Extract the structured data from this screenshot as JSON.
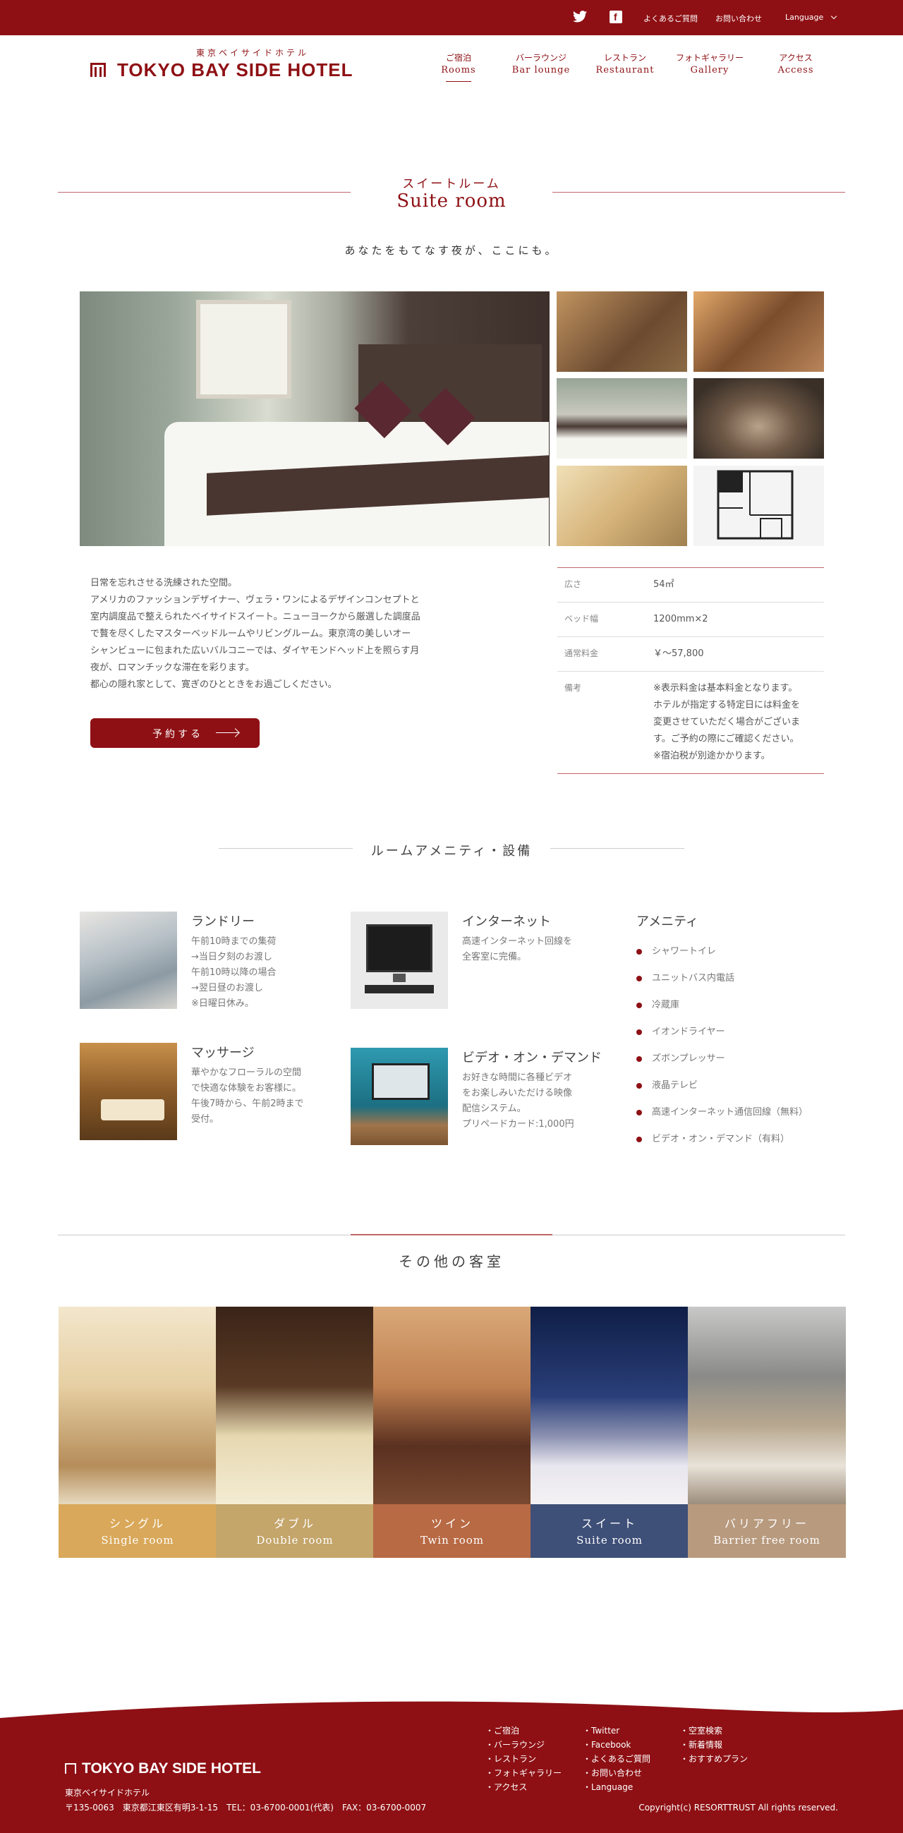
{
  "topbar": {
    "faq": "よくあるご質問",
    "contact": "お問い合わせ",
    "language": "Language",
    "icons": [
      "twitter-icon",
      "facebook-icon"
    ]
  },
  "header": {
    "logo_jp": "東京ベイサイドホテル",
    "logo_en": "TOKYO BAY SIDE HOTEL",
    "nav": [
      {
        "jp": "ご宿泊",
        "en": "Rooms"
      },
      {
        "jp": "バーラウンジ",
        "en": "Bar lounge"
      },
      {
        "jp": "レストラン",
        "en": "Restaurant"
      },
      {
        "jp": "フォトギャラリー",
        "en": "Gallery"
      },
      {
        "jp": "アクセス",
        "en": "Access"
      }
    ]
  },
  "suite": {
    "title_jp": "スイートルーム",
    "title_en": "Suite room",
    "tagline": "あなたをもてなす夜が、ここにも。",
    "description": [
      "日常を忘れさせる洗練された空間。",
      "アメリカのファッションデザイナー、ヴェラ・ワンによるデザインコンセプトと",
      "室内調度品で整えられたベイサイドスイート。ニューヨークから厳選した調度品",
      "で贅を尽くしたマスターベッドルームやリビングルーム。東京湾の美しいオー",
      "シャンビューに包まれた広いバルコニーでは、ダイヤモンドヘッド上を照らす月",
      "夜が、ロマンチックな滞在を彩ります。",
      "都心の隠れ家として、寛ぎのひとときをお過ごしください。"
    ],
    "reserve_label": "予約する",
    "specs": [
      {
        "k": "広さ",
        "v": "54㎡"
      },
      {
        "k": "ベッド幅",
        "v": "1200mm×2"
      },
      {
        "k": "通常料金",
        "v": "￥～57,800"
      },
      {
        "k": "備考",
        "v": [
          "※表示料金は基本料金となります。",
          "ホテルが指定する特定日には料金を",
          "変更させていただく場合がございま",
          "す。ご予約の際にご確認ください。",
          "※宿泊税が別途かかります。"
        ]
      }
    ]
  },
  "amenities": {
    "title": "ルームアメニティ・設備",
    "items": [
      {
        "title": "ランドリー",
        "text": [
          "午前10時までの集荷",
          "→当日夕刻のお渡し",
          "午前10時以降の場合",
          "→翌日昼のお渡し",
          "※日曜日休み。"
        ]
      },
      {
        "title": "インターネット",
        "text": [
          "高速インターネット回線を",
          "全客室に完備。"
        ]
      },
      {
        "title": "マッサージ",
        "text": [
          "華やかなフローラルの空間",
          "で快適な体験をお客様に。",
          "午後7時から、午前2時まで",
          "受付。"
        ]
      },
      {
        "title": "ビデオ・オン・デマンド",
        "text": [
          "お好きな時間に各種ビデオ",
          "をお楽しみいただける映像",
          "配信システム。",
          "プリペードカード:1,000円"
        ]
      }
    ],
    "list_title": "アメニティ",
    "list": [
      "シャワートイレ",
      "ユニットバス内電話",
      "冷蔵庫",
      "イオンドライヤー",
      "ズボンプレッサー",
      "液晶テレビ",
      "高速インターネット通信回線（無料）",
      "ビデオ・オン・デマンド（有料）"
    ]
  },
  "other_rooms": {
    "title": "その他の客室",
    "rooms": [
      {
        "jp": "シングル",
        "en": "Single room",
        "color": "#d9a85a"
      },
      {
        "jp": "ダブル",
        "en": "Double room",
        "color": "#c4a56a"
      },
      {
        "jp": "ツイン",
        "en": "Twin room",
        "color": "#b86a44"
      },
      {
        "jp": "スイート",
        "en": "Suite room",
        "color": "#3e4f78"
      },
      {
        "jp": "バリアフリー",
        "en": "Barrier free room",
        "color": "#b89a7e"
      }
    ]
  },
  "footer": {
    "logo": "TOKYO BAY SIDE HOTEL",
    "name": "東京ベイサイドホテル",
    "address": "〒135-0063　東京都江東区有明3-1-15　TEL：03-6700-0001(代表)　FAX：03-6700-0007",
    "col1": [
      "・ご宿泊",
      "・バーラウンジ",
      "・レストラン",
      "・フォトギャラリー",
      "・アクセス"
    ],
    "col2": [
      "・Twitter",
      "・Facebook",
      "・よくあるご質問",
      "・お問い合わせ",
      "・Language"
    ],
    "col3": [
      "・空室検索",
      "・新着情報",
      "・おすすめプラン"
    ],
    "copyright": "Copyright(c) RESORTTRUST All rights reserved."
  }
}
